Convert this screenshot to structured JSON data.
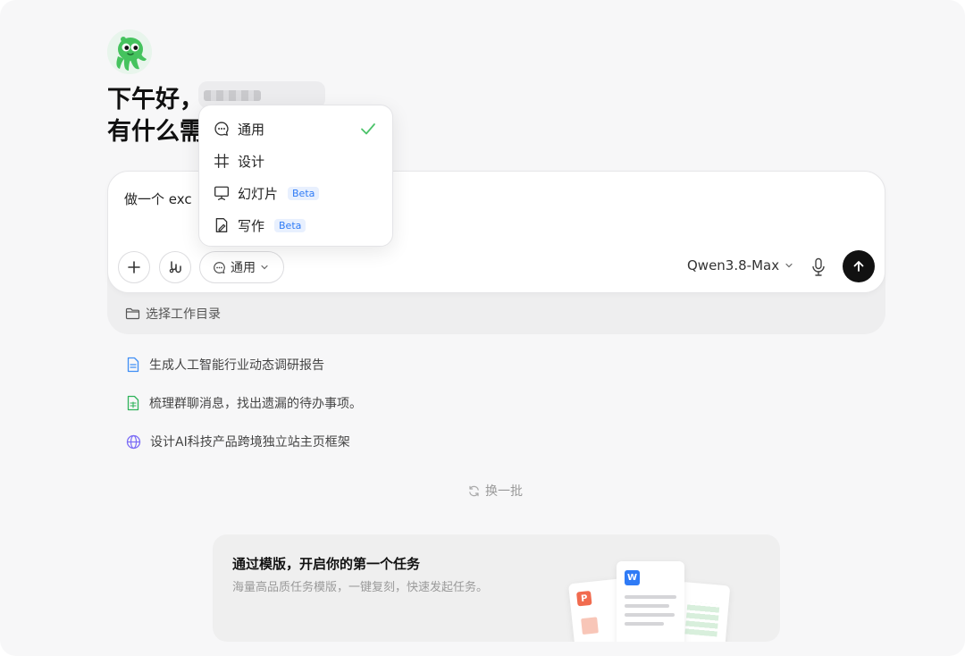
{
  "greeting": {
    "line1": "下午好，",
    "line2": "有什么需"
  },
  "composer": {
    "text": "做一个 exc",
    "mode_label": "通用",
    "model_label": "Qwen3.8-Max",
    "workdir_label": "选择工作目录"
  },
  "mode_menu": {
    "items": [
      {
        "label": "通用",
        "icon": "chat-bubble-icon",
        "selected": true
      },
      {
        "label": "设计",
        "icon": "hash-frame-icon"
      },
      {
        "label": "幻灯片",
        "icon": "presentation-icon",
        "badge": "Beta"
      },
      {
        "label": "写作",
        "icon": "pen-document-icon",
        "badge": "Beta"
      }
    ]
  },
  "suggestions": [
    {
      "label": "生成人工智能行业动态调研报告",
      "icon": "document-icon"
    },
    {
      "label": "梳理群聊消息，找出遗漏的待办事项。",
      "icon": "spreadsheet-icon"
    },
    {
      "label": "设计AI科技产品跨境独立站主页框架",
      "icon": "globe-icon"
    }
  ],
  "refresh_label": "换一批",
  "template_card": {
    "title": "通过模版，开启你的第一个任务",
    "subtitle": "海量高品质任务模版，一键复刻，快速发起任务。",
    "doc_badges": [
      "W",
      "P"
    ]
  },
  "colors": {
    "accent_green": "#4cc36a",
    "beta_blue": "#2f7bf6",
    "send_button": "#111111"
  }
}
